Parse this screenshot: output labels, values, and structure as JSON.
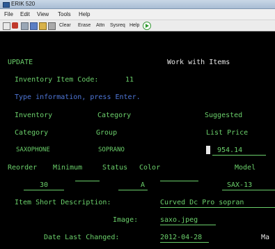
{
  "window": {
    "title": "ERIK 520"
  },
  "menu": {
    "items": [
      "File",
      "Edit",
      "View",
      "Tools",
      "Help"
    ]
  },
  "toolbar": {
    "labels": [
      "Clear",
      "Erase",
      "Attn",
      "Sysreq",
      "Help"
    ]
  },
  "screen": {
    "option": "UPDATE",
    "screen_title": "Work with Items",
    "item_code_label": "Inventory Item Code:",
    "item_code_value": "11",
    "instruction": "Type information, press Enter.",
    "col_inventory": "Inventory",
    "col_category_hdr": "Category",
    "col_suggested": "Suggested",
    "col_category": "Category",
    "col_group": "Group",
    "col_list_price": "List Price",
    "category_value": "SAXOPHONE",
    "group_value": "SOPRANO",
    "list_price_value": "954.14",
    "reorder_label": "Reorder",
    "minimum_label": "Minimum",
    "status_label": "Status",
    "color_label": "Color",
    "model_label": "Model",
    "minimum_value": "30",
    "status_value": "A",
    "model_value": "SAX-13",
    "short_desc_label": "Item Short Description:",
    "short_desc_value": "Curved Dc Pro sopran",
    "image_label": "Image:",
    "image_value": "saxo.jpeg",
    "date_label": "Date Last Changed:",
    "date_value": "2012-04-28",
    "trailing_label": "Ma"
  }
}
